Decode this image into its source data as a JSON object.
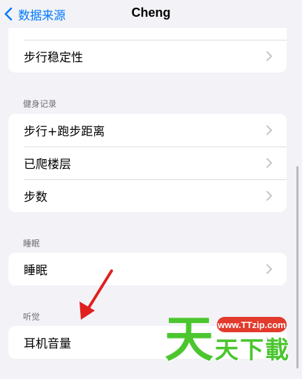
{
  "nav": {
    "back_label": "数据来源",
    "title": "Cheng"
  },
  "sections": {
    "top": {
      "items": [
        {
          "label": "步行稳定性"
        }
      ]
    },
    "fitness": {
      "header": "健身记录",
      "items": [
        {
          "label": "步行+跑步距离"
        },
        {
          "label": "已爬楼层"
        },
        {
          "label": "步数"
        }
      ]
    },
    "sleep": {
      "header": "睡眠",
      "items": [
        {
          "label": "睡眠"
        }
      ]
    },
    "hearing": {
      "header": "听觉",
      "items": [
        {
          "label": "耳机音量"
        }
      ]
    }
  },
  "watermark": {
    "url": "www.TTzip.com",
    "big_char": "天",
    "small_chars": [
      "天",
      "下",
      "載"
    ]
  },
  "colors": {
    "accent": "#007aff",
    "background": "#f2f2f7",
    "arrow": "#e0201c",
    "watermark_green": "#4bc62f",
    "watermark_badge": "#e23a2c"
  }
}
